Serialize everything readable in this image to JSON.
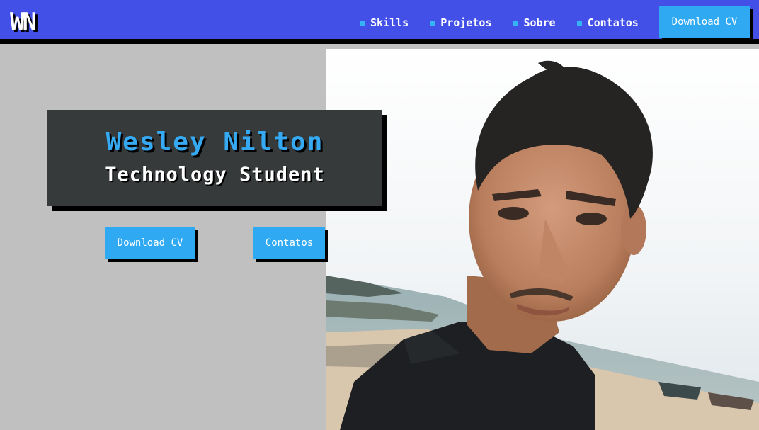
{
  "logo": {
    "text": "WN"
  },
  "nav": {
    "links": [
      {
        "label": "Skills"
      },
      {
        "label": "Projetos"
      },
      {
        "label": "Sobre"
      },
      {
        "label": "Contatos"
      }
    ],
    "cta_label": "Download CV"
  },
  "hero": {
    "name": "Wesley Nilton",
    "role": "Technology Student",
    "buttons": [
      {
        "label": "Download CV"
      },
      {
        "label": "Contatos"
      }
    ]
  },
  "colors": {
    "nav_bg": "#4350e8",
    "accent": "#2fa9f2",
    "card_bg": "#363a3a",
    "page_bg": "#c0c0c0"
  }
}
